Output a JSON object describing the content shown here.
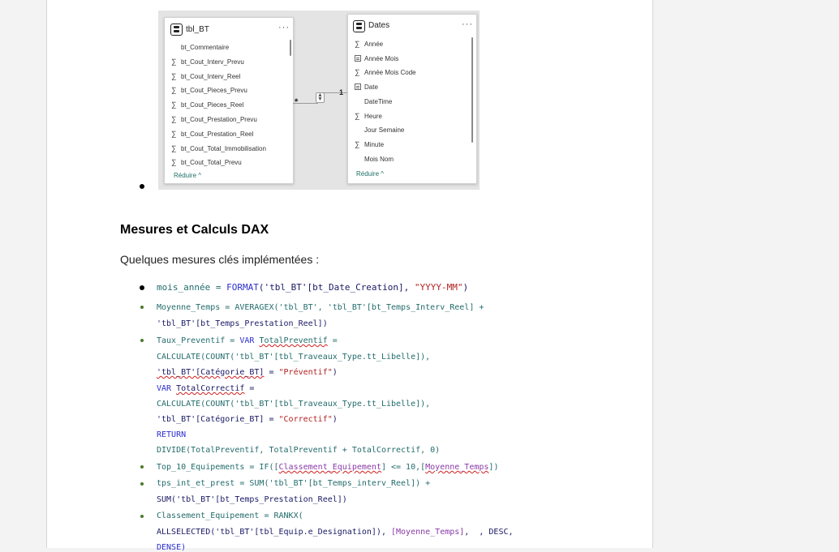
{
  "diagram": {
    "left_table": {
      "title": "tbl_BT",
      "more": "···",
      "fields": [
        {
          "icon": "none",
          "label": "bt_Commentaire"
        },
        {
          "icon": "sigma",
          "label": "bt_Cout_Interv_Prevu"
        },
        {
          "icon": "sigma",
          "label": "bt_Cout_Interv_Reel"
        },
        {
          "icon": "sigma",
          "label": "bt_Cout_Pieces_Prevu"
        },
        {
          "icon": "sigma",
          "label": "bt_Cout_Pieces_Reel"
        },
        {
          "icon": "sigma",
          "label": "bt_Cout_Prestation_Prevu"
        },
        {
          "icon": "sigma",
          "label": "bt_Cout_Prestation_Reel"
        },
        {
          "icon": "sigma",
          "label": "bt_Cout_Total_Immobilisation"
        },
        {
          "icon": "sigma",
          "label": "bt_Cout_Total_Prevu"
        }
      ],
      "reduce": "Réduire ^"
    },
    "right_table": {
      "title": "Dates",
      "more": "···",
      "fields": [
        {
          "icon": "sigma",
          "label": "Année"
        },
        {
          "icon": "table",
          "label": "Année Mois"
        },
        {
          "icon": "sigma",
          "label": "Année Mois Code"
        },
        {
          "icon": "table",
          "label": "Date"
        },
        {
          "icon": "none",
          "label": "DateTime"
        },
        {
          "icon": "sigma",
          "label": "Heure"
        },
        {
          "icon": "none",
          "label": "Jour Semaine"
        },
        {
          "icon": "sigma",
          "label": "Minute"
        },
        {
          "icon": "none",
          "label": "Mois Nom"
        }
      ],
      "reduce": "Réduire ^"
    },
    "relationship": {
      "many": "*",
      "one": "1"
    }
  },
  "section": {
    "heading": "Mesures et Calculs DAX",
    "intro": "Quelques mesures clés implémentées :"
  },
  "code": {
    "m1": {
      "name": "mois_année",
      "eq": " = ",
      "fn": "FORMAT",
      "arg1": "('tbl_BT'[bt_Date_Creation], ",
      "arg2": "\"YYYY-MM\"",
      "close": ")"
    },
    "m2_l1": "Moyenne_Temps = AVERAGEX('tbl_BT', 'tbl_BT'[bt_Temps_Interv_Reel] +",
    "m2_l2": "'tbl_BT'[bt_Temps_Prestation_Reel])",
    "m3_l1a": "Taux_Preventif = ",
    "m3_l1b": "VAR",
    "m3_l1c": "TotalPreventif",
    "m3_l1d": " =",
    "m3_l2": "CALCULATE(COUNT('tbl_BT'[tbl_Traveaux_Type.tt_Libelle]),",
    "m3_l3a": "'tbl_BT'[Catégorie_BT]",
    "m3_l3b": " = ",
    "m3_l3c": "\"Préventif\"",
    "m3_l3d": ")",
    "m3_l4a": "VAR",
    "m3_l4b": "TotalCorrectif",
    "m3_l4c": " =",
    "m3_l5": "CALCULATE(COUNT('tbl_BT'[tbl_Traveaux_Type.tt_Libelle]),",
    "m3_l6a": "'tbl_BT'[Catégorie_BT] = ",
    "m3_l6b": "\"Correctif\"",
    "m3_l6c": ")",
    "m3_l7": "RETURN",
    "m3_l8": "DIVIDE(TotalPreventif, TotalPreventif + TotalCorrectif, 0)",
    "m4a": "Top_10_Equipements = IF([",
    "m4b": "Classement_Equipement",
    "m4c": "] <= 10,[",
    "m4d": "Moyenne_Temps",
    "m4e": "])",
    "m5_l1": "tps_int_et_prest = SUM('tbl_BT'[bt_Temps_interv_Reel]) +",
    "m5_l2": "SUM('tbl_BT'[bt_Temps_Prestation_Reel])",
    "m6_l1": "Classement_Equipement = RANKX(",
    "m6_l2a": "ALLSELECTED('tbl_BT'[tbl_Equip.e_Designation]), ",
    "m6_l2b": "[Moyenne_Temps]",
    "m6_l2c": ",  , DESC,",
    "m6_l3": "DENSE)"
  }
}
